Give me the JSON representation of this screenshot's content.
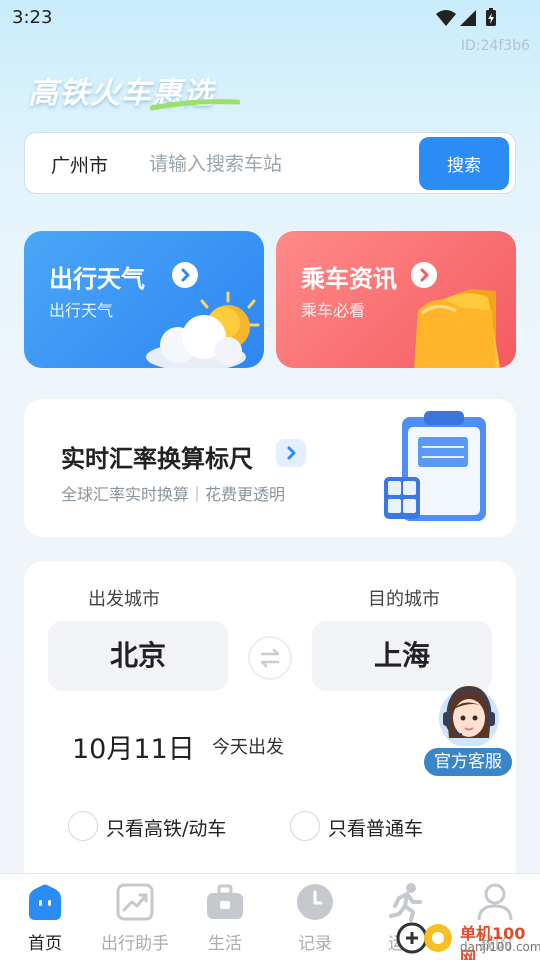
{
  "status_bar": {
    "time": "3:23",
    "icons": [
      "wifi-icon",
      "signal-icon",
      "battery-icon"
    ]
  },
  "page_id": "ID:24f3b6",
  "app": {
    "logo_text": "高铁火车惠选"
  },
  "search": {
    "city": "广州市",
    "placeholder": "请输入搜索车站",
    "button_label": "搜索"
  },
  "cards": {
    "weather": {
      "title": "出行天气",
      "subtitle": "出行天气",
      "illustration": "sun-cloud-icon"
    },
    "news": {
      "title": "乘车资讯",
      "subtitle": "乘车必看",
      "illustration": "folder-icon"
    }
  },
  "exchange": {
    "title": "实时汇率换算标尺",
    "subtitle": "全球汇率实时换算｜花费更透明",
    "illustration": "clipboard-calculator-icon"
  },
  "ticket": {
    "from_label": "出发城市",
    "to_label": "目的城市",
    "from_city": "北京",
    "to_city": "上海",
    "date": "10月11日",
    "date_hint": "今天出发",
    "option_highspeed": "只看高铁/动车",
    "option_normal": "只看普通车"
  },
  "service": {
    "label": "官方客服",
    "icon": "customer-service-avatar"
  },
  "tabbar": {
    "items": [
      {
        "label": "首页",
        "icon": "home-icon",
        "active": true
      },
      {
        "label": "出行助手",
        "icon": "trend-chart-icon",
        "active": false
      },
      {
        "label": "生活",
        "icon": "toolbox-icon",
        "active": false
      },
      {
        "label": "记录",
        "icon": "clock-icon",
        "active": false
      },
      {
        "label": "运动",
        "icon": "running-icon",
        "active": false
      },
      {
        "label": "我的",
        "icon": "user-icon",
        "active": false
      }
    ]
  },
  "watermark": {
    "name": "单机100网",
    "domain": "danji100.com"
  },
  "colors": {
    "primary": "#2b8cf5",
    "weather_card": "#3a93f4",
    "news_card": "#f6686b",
    "service_badge": "#3a86c8"
  }
}
